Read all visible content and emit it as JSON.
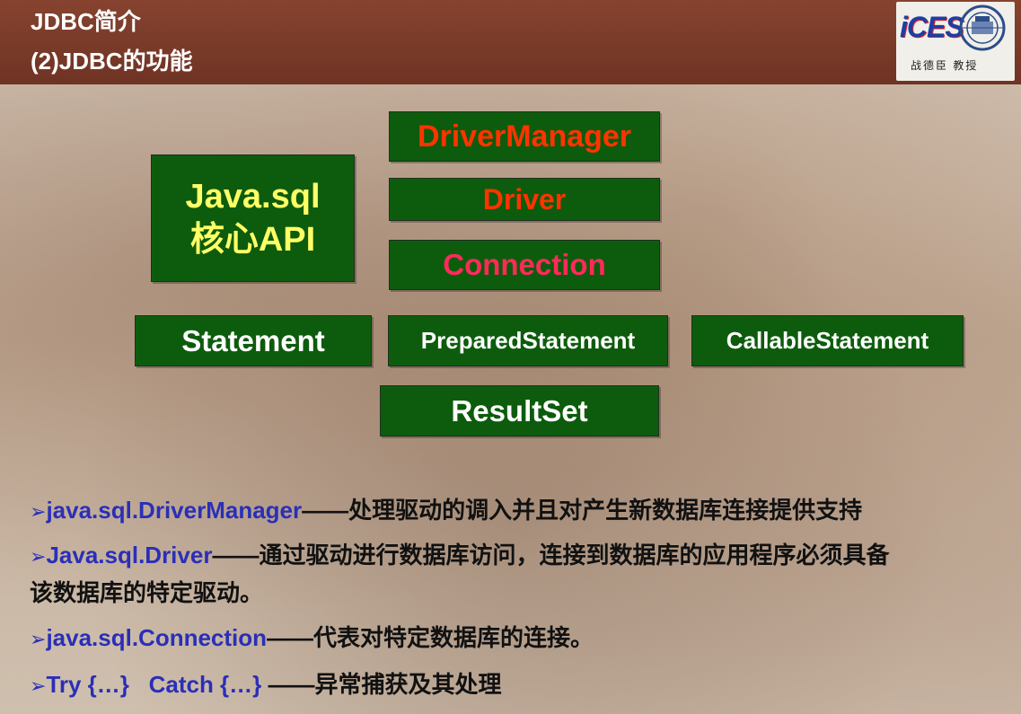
{
  "header": {
    "title_line1": "JDBC简介",
    "title_line2": "(2)JDBC的功能",
    "logo_text": "iCES",
    "logo_caption": "战德臣 教授"
  },
  "diagram": {
    "core_line1": "Java.sql",
    "core_line2": "核心API",
    "driver_manager": "DriverManager",
    "driver": "Driver",
    "connection": "Connection",
    "statement": "Statement",
    "prepared_statement": "PreparedStatement",
    "callable_statement": "CallableStatement",
    "result_set": "ResultSet"
  },
  "bullets": {
    "marker": "➢",
    "b1_key": "java.sql.DriverManager",
    "b1_text": "——处理驱动的调入并且对产生新数据库连接提供支持",
    "b2_key": "Java.sql.Driver",
    "b2_text": "——通过驱动进行数据库访问，连接到数据库的应用程序必须具备",
    "b2_text2": "该数据库的特定驱动。",
    "b3_key": "java.sql.Connection",
    "b3_text": "——代表对特定数据库的连接。",
    "b4_key": "Try {…}   Catch {…}",
    "b4_text": " ——异常捕获及其处理"
  },
  "colors": {
    "header_bg": "#7a3a2a",
    "box_bg": "#0d5c0d",
    "core_text": "#ffff66",
    "highlight_red": "#ff3300",
    "highlight_pink": "#ff2a5a",
    "keyword_blue": "#2a2fb8"
  }
}
